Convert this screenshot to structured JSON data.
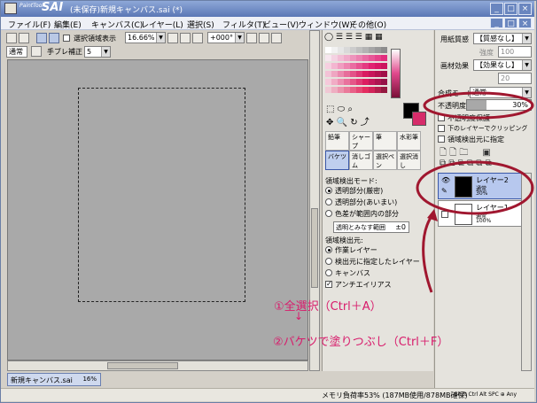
{
  "window": {
    "brand_small": "PaintTool",
    "brand": "SAI",
    "doc_title": "(未保存)新規キャンバス.sai (*)"
  },
  "menu": [
    "ファイル(F)",
    "編集(E)",
    "キャンバス(C)",
    "レイヤー(L)",
    "選択(S)",
    "フィルタ(T)",
    "ビュー(V)",
    "ウィンドウ(W)",
    "その他(O)"
  ],
  "toolbar": {
    "show_sel_label": "選択領域表示",
    "zoom": "16.66%",
    "angle": "+000°",
    "blend_mode": "通常",
    "stab_label": "手ブレ補正",
    "stab_value": "5"
  },
  "canvas_tab": {
    "name": "新規キャンバス.sai",
    "zoom": "16%"
  },
  "status": {
    "memory": "メモリ負荷率53% (187MB使用/878MB確保)",
    "keys": "Shift Ctrl Alt SPC ⊕ Any"
  },
  "swatches": [
    "#ffffff",
    "#f2f2f2",
    "#e6e6e6",
    "#d9d9d9",
    "#cccccc",
    "#bfbfbf",
    "#b3b3b3",
    "#a6a6a6",
    "#999999",
    "#8c8c8c",
    "#f7e7ef",
    "#f4d2e2",
    "#f2bdd5",
    "#f0a9c9",
    "#ee94bc",
    "#ec80b0",
    "#e96ba3",
    "#e75797",
    "#e5428a",
    "#e32e7e",
    "#f6cfe0",
    "#f3b6d0",
    "#f09dc0",
    "#ed85b0",
    "#ea6ca1",
    "#e75391",
    "#e43b81",
    "#e12271",
    "#d91766",
    "#cc145e",
    "#f3c2d6",
    "#efa6c2",
    "#eb8aaf",
    "#e76e9b",
    "#e35288",
    "#de3675",
    "#d91a61",
    "#c8155a",
    "#b41250",
    "#a00f47",
    "#f5c9da",
    "#f1acc5",
    "#ed8fb1",
    "#e9729d",
    "#e55688",
    "#e03974",
    "#dc1d60",
    "#c4185a",
    "#ad1550",
    "#951247",
    "#f0c8d4",
    "#eeaec1",
    "#ec94ad",
    "#ea7a9a",
    "#e86087",
    "#e64774",
    "#e42d60",
    "#d2245a",
    "#b31f4d",
    "#941940"
  ],
  "tools": [
    "鉛筆",
    "シャープ",
    "筆",
    "水彩筆",
    "バケツ",
    "消しゴム",
    "選択ペン",
    "選択消し"
  ],
  "bucket_options": {
    "mode_label": "領域検出モード:",
    "modes": [
      "透明部分(厳密)",
      "透明部分(あいまい)",
      "色差が範囲内の部分"
    ],
    "range_label": "透明とみなす範囲",
    "range_value": "±0",
    "source_label": "領域検出元:",
    "sources": [
      "作業レイヤー",
      "検出元に指定したレイヤー",
      "キャンバス"
    ],
    "antialias": "アンチエイリアス"
  },
  "layer_panel": {
    "paper_label": "用紙質感",
    "paper_value": "【質感なし】",
    "strength_label": "強度",
    "strength_value": "100",
    "effect_label": "画材効果",
    "effect_value": "【効果なし】",
    "effect_strength": "20",
    "blend_label": "合成モード",
    "blend_value": "通常",
    "opacity_label": "不透明度",
    "opacity_value": "30%",
    "opacity": 0.3,
    "opt1": "不透明度保護",
    "opt2": "下のレイヤーでクリッピング",
    "opt3": "領域検出元に指定"
  },
  "layers": [
    {
      "name": "レイヤー2",
      "mode": "通常",
      "opacity": "30%"
    },
    {
      "name": "レイヤー1",
      "mode": "通常",
      "opacity": "100%"
    }
  ],
  "annotations": {
    "step1": "①全選択（Ctrl＋A）",
    "arrow": "↓",
    "step2": "②バケツで塗りつぶし（Ctrl＋F）"
  },
  "highlight_color": "#a0172f"
}
